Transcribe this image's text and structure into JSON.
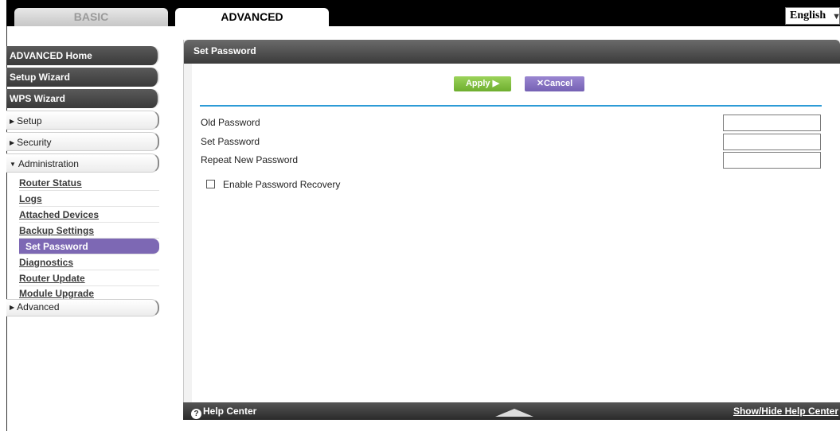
{
  "tabs": {
    "basic": "BASIC",
    "advanced": "ADVANCED"
  },
  "language": {
    "selected": "English"
  },
  "sidebar": {
    "top_items": [
      "ADVANCED Home",
      "Setup Wizard",
      "WPS Wizard"
    ],
    "sections": [
      {
        "label": "Setup",
        "expanded": false
      },
      {
        "label": "Security",
        "expanded": false
      },
      {
        "label": "Administration",
        "expanded": true
      }
    ],
    "admin_items": [
      "Router Status",
      "Logs",
      "Attached Devices",
      "Backup Settings",
      "Set Password",
      "Diagnostics",
      "Router Update",
      "Module Upgrade"
    ],
    "active_item": "Set Password",
    "advanced_label": "Advanced"
  },
  "panel": {
    "title": "Set Password",
    "apply_label": "Apply ▶",
    "cancel_label": "✕Cancel",
    "fields": [
      "Old Password",
      "Set Password",
      "Repeat New Password"
    ],
    "checkbox_label": "Enable Password Recovery"
  },
  "footer": {
    "help": "Help Center",
    "toggle": "Show/Hide Help Center"
  },
  "colors": {
    "accent_blue": "#2d9bd6",
    "apply_green": "#7fbf3f",
    "cancel_purple": "#8571c2",
    "active_purple": "#7d68b4"
  }
}
